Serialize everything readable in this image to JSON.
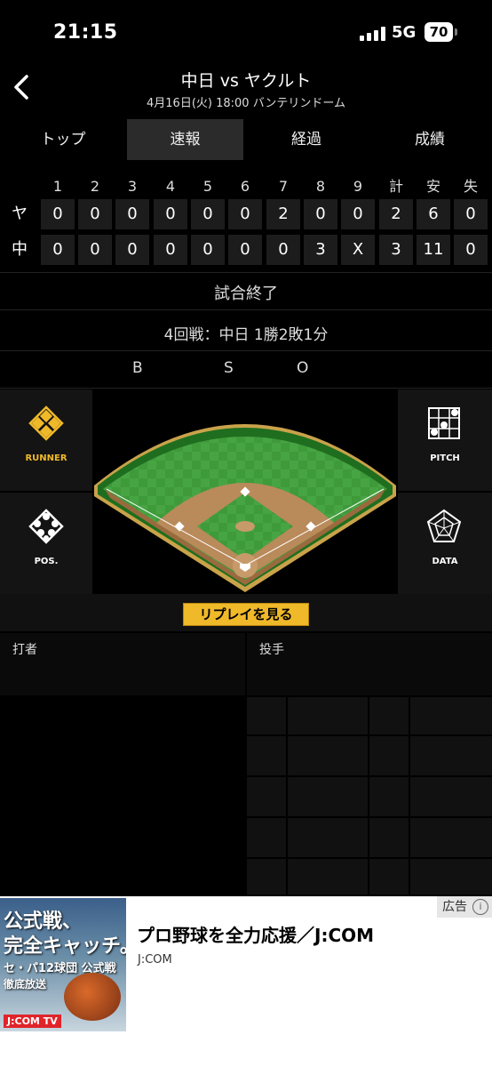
{
  "status_bar": {
    "time": "21:15",
    "network": "5G",
    "battery": "70"
  },
  "header": {
    "title": "中日 vs ヤクルト",
    "subtitle": "4月16日(火) 18:00 バンテリンドーム"
  },
  "tabs": [
    {
      "label": "トップ"
    },
    {
      "label": "速報"
    },
    {
      "label": "経過"
    },
    {
      "label": "成績"
    }
  ],
  "scoreboard": {
    "headers": [
      "1",
      "2",
      "3",
      "4",
      "5",
      "6",
      "7",
      "8",
      "9",
      "計",
      "安",
      "失"
    ],
    "rows": [
      {
        "team": "ヤ",
        "cells": [
          "0",
          "0",
          "0",
          "0",
          "0",
          "0",
          "2",
          "0",
          "0",
          "2",
          "6",
          "0"
        ]
      },
      {
        "team": "中",
        "cells": [
          "0",
          "0",
          "0",
          "0",
          "0",
          "0",
          "0",
          "3",
          "X",
          "3",
          "11",
          "0"
        ]
      }
    ]
  },
  "status": {
    "result": "試合終了",
    "series": "4回戦：中日 1勝2敗1分"
  },
  "count": {
    "b": "B",
    "s": "S",
    "o": "O"
  },
  "panels": {
    "runner": "RUNNER",
    "pitch": "PITCH",
    "pos": "POS.",
    "data": "DATA"
  },
  "replay": "リプレイを見る",
  "labels": {
    "batter": "打者",
    "pitcher": "投手"
  },
  "ad": {
    "badge": "広告",
    "title": "プロ野球を全力応援／J:COM",
    "advertiser": "J:COM",
    "image_text": {
      "line1": "公式戦、",
      "line2": "完全キャッチ。",
      "line3": "セ・パ12球団 公式戦",
      "line4": "徹底放送",
      "brand": "J:COM TV"
    }
  },
  "colors": {
    "accent": "#f0b92a",
    "field_green": "#3f9a3a",
    "dirt": "#b98a5a"
  }
}
